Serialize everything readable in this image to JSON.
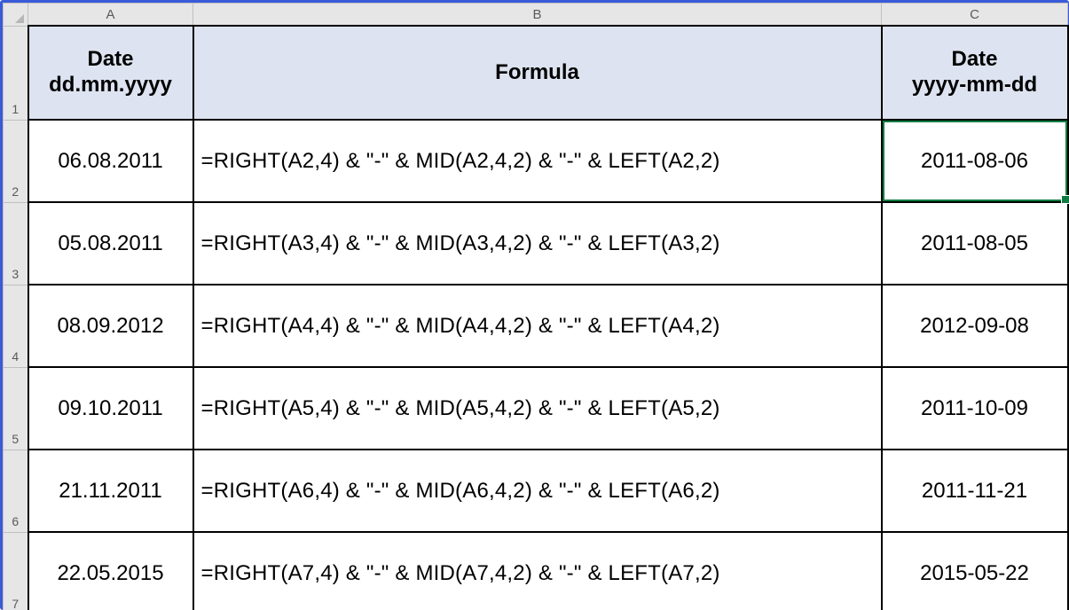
{
  "columns": {
    "letters": [
      "A",
      "B",
      "C"
    ],
    "gutter": ""
  },
  "rowNumbers": [
    "1",
    "2",
    "3",
    "4",
    "5",
    "6",
    "7"
  ],
  "header": {
    "a_line1": "Date",
    "a_line2": "dd.mm.yyyy",
    "b": "Formula",
    "c_line1": "Date",
    "c_line2": "yyyy-mm-dd"
  },
  "rows": [
    {
      "a": "06.08.2011",
      "b": "=RIGHT(A2,4) & \"-\" & MID(A2,4,2) & \"-\" & LEFT(A2,2)",
      "c": "2011-08-06"
    },
    {
      "a": "05.08.2011",
      "b": "=RIGHT(A3,4) & \"-\" & MID(A3,4,2) & \"-\" & LEFT(A3,2)",
      "c": "2011-08-05"
    },
    {
      "a": "08.09.2012",
      "b": "=RIGHT(A4,4) & \"-\" & MID(A4,4,2) & \"-\" & LEFT(A4,2)",
      "c": "2012-09-08"
    },
    {
      "a": "09.10.2011",
      "b": "=RIGHT(A5,4) & \"-\" & MID(A5,4,2) & \"-\" & LEFT(A5,2)",
      "c": "2011-10-09"
    },
    {
      "a": "21.11.2011",
      "b": "=RIGHT(A6,4) & \"-\" & MID(A6,4,2) & \"-\" & LEFT(A6,2)",
      "c": "2011-11-21"
    },
    {
      "a": "22.05.2015",
      "b": "=RIGHT(A7,4) & \"-\" & MID(A7,4,2) & \"-\" & LEFT(A7,2)",
      "c": "2015-05-22"
    }
  ],
  "selectedCell": "C2"
}
